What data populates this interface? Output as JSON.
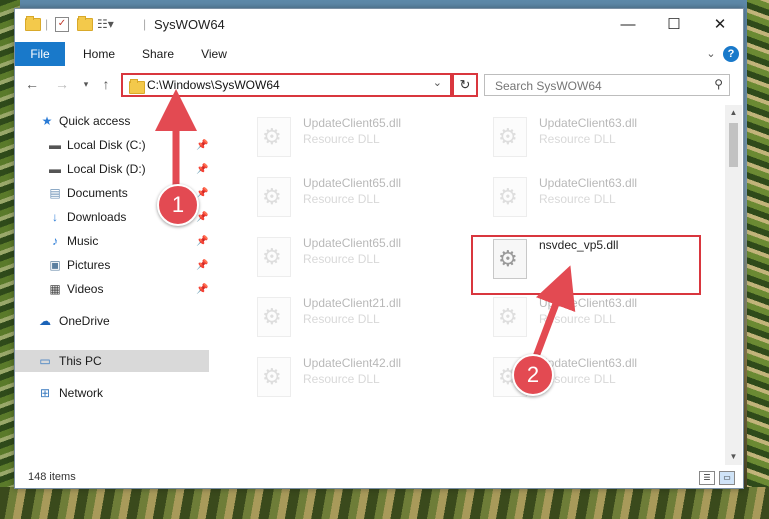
{
  "window": {
    "title": "SysWOW64",
    "controls": {
      "minimize": "—",
      "maximize": "☐",
      "close": "✕"
    }
  },
  "ribbon": {
    "tabs": [
      "File",
      "Home",
      "Share",
      "View"
    ],
    "expand_icon": "chevron-down-icon",
    "help_label": "?"
  },
  "address": {
    "path": "C:\\Windows\\SysWOW64",
    "search_placeholder": "Search SysWOW64"
  },
  "nav": {
    "quick_access": "Quick access",
    "items": [
      {
        "label": "Local Disk (C:)",
        "pinned": true
      },
      {
        "label": "Local Disk (D:)",
        "pinned": true
      },
      {
        "label": "Documents",
        "pinned": true
      },
      {
        "label": "Downloads",
        "pinned": true
      },
      {
        "label": "Music",
        "pinned": true
      },
      {
        "label": "Pictures",
        "pinned": true
      },
      {
        "label": "Videos",
        "pinned": true
      }
    ],
    "onedrive": "OneDrive",
    "this_pc": "This PC",
    "network": "Network"
  },
  "files": [
    {
      "name": "UpdateClient65.dll",
      "type": "Resource DLL"
    },
    {
      "name": "UpdateClient63.dll",
      "type": "Resource DLL"
    },
    {
      "name": "UpdateClient65.dll",
      "type": "Resource DLL"
    },
    {
      "name": "UpdateClient63.dll",
      "type": "Resource DLL"
    },
    {
      "name": "UpdateClient65.dll",
      "type": "Resource DLL"
    },
    {
      "name": "nsvdec_vp5.dll",
      "type": ""
    },
    {
      "name": "UpdateClient21.dll",
      "type": "Resource DLL"
    },
    {
      "name": "UpdateClient63.dll",
      "type": "Resource DLL"
    },
    {
      "name": "UpdateClient42.dll",
      "type": "Resource DLL"
    },
    {
      "name": "UpdateClient63.dll",
      "type": "Resource DLL"
    }
  ],
  "status": {
    "item_count": "148 items"
  },
  "annotations": {
    "step1": "1",
    "step2": "2",
    "color": "#e34a52"
  }
}
